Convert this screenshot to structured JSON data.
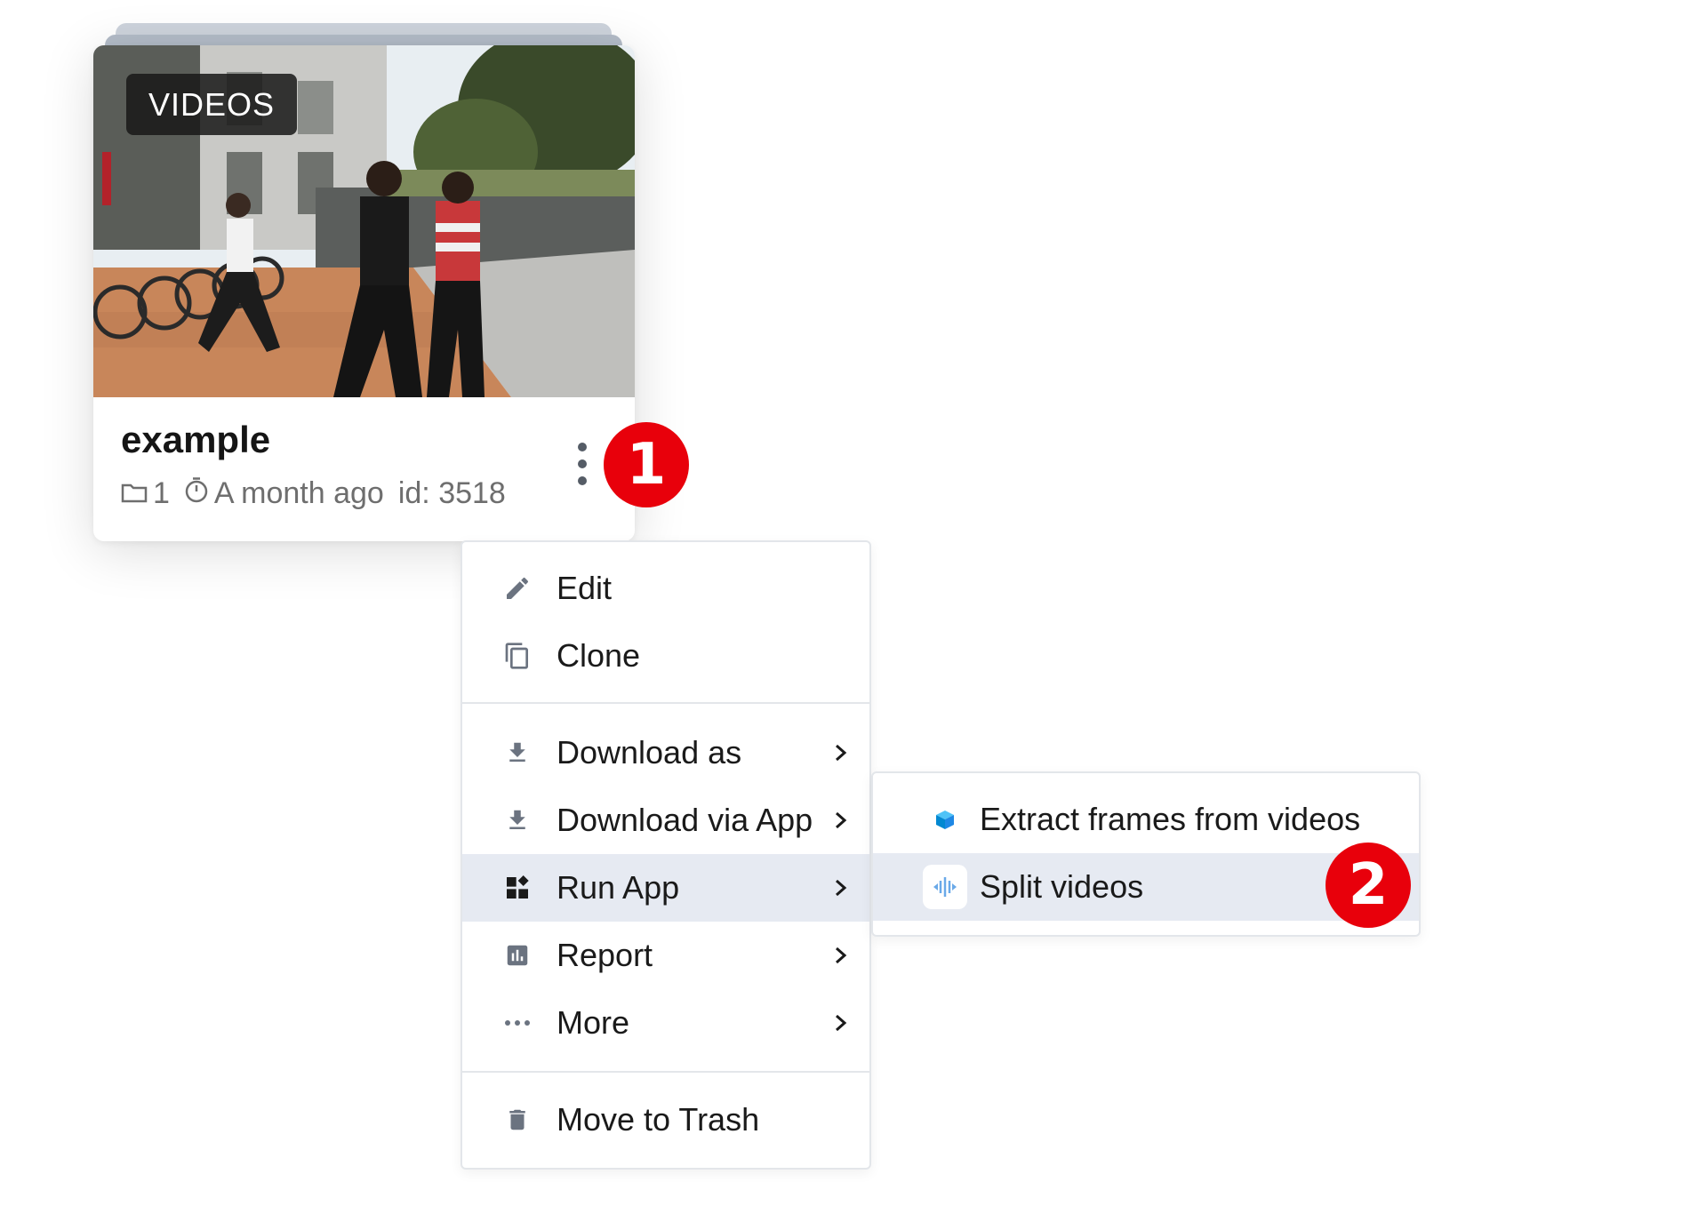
{
  "project_card": {
    "type_badge": "VIDEOS",
    "title": "example",
    "meta": {
      "datasets_count": "1",
      "updated": "A month ago",
      "id_label": "id: 3518"
    },
    "icons": {
      "folder": "folder-icon",
      "timer": "timer-icon",
      "more": "kebab-menu-icon"
    }
  },
  "markers": {
    "step_1": "1",
    "step_2": "2",
    "color": "#e8000b"
  },
  "context_menu": {
    "groups": [
      [
        {
          "label": "Edit",
          "icon": "pencil-icon"
        },
        {
          "label": "Clone",
          "icon": "copy-icon"
        }
      ],
      [
        {
          "label": "Download as",
          "icon": "download-icon",
          "has_submenu": true
        },
        {
          "label": "Download via App",
          "icon": "download-icon",
          "has_submenu": true
        },
        {
          "label": "Run App",
          "icon": "apps-icon",
          "has_submenu": true,
          "active": true
        },
        {
          "label": "Report",
          "icon": "chart-icon",
          "has_submenu": true
        },
        {
          "label": "More",
          "icon": "dots-icon",
          "has_submenu": true
        }
      ],
      [
        {
          "label": "Move to Trash",
          "icon": "trash-icon"
        }
      ]
    ]
  },
  "run_app_submenu": {
    "items": [
      {
        "label": "Extract frames from videos",
        "icon": "cube-icon"
      },
      {
        "label": "Split videos",
        "icon": "split-icon",
        "active": true
      }
    ]
  },
  "colors": {
    "active_row": "#e6eaf2",
    "icon_gray": "#6b7380",
    "accent_blue": "#1e88e5"
  }
}
